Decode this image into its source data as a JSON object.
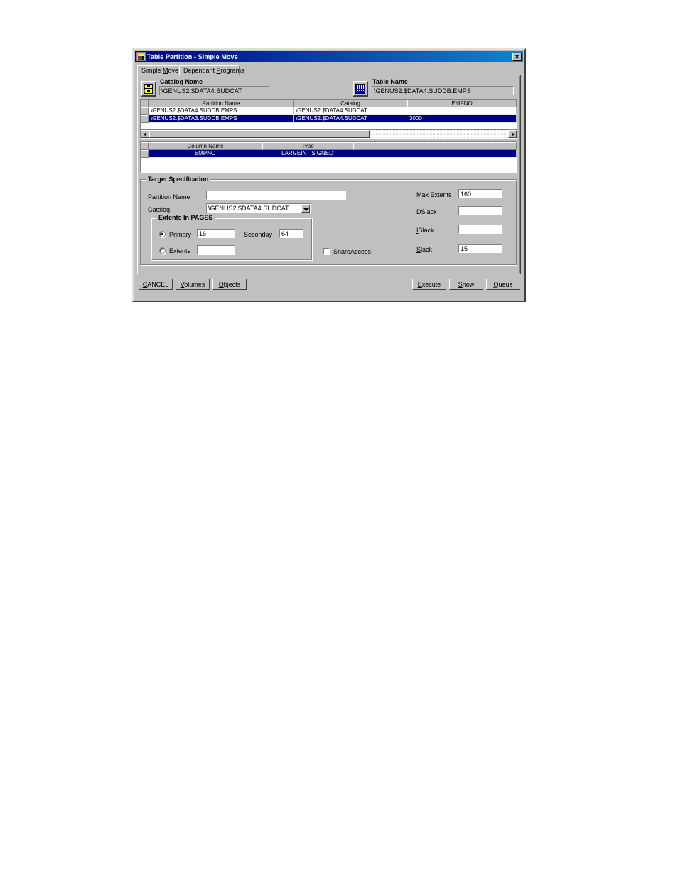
{
  "window": {
    "title": "Table Partition - Simple Move",
    "close_label": "✕",
    "icon": "app-icon"
  },
  "tabs": [
    {
      "label_pre": "Simple ",
      "label_acc": "M",
      "label_post": "ove",
      "active": true
    },
    {
      "label_pre": "Dependant ",
      "label_acc": "P",
      "label_post": "rograms",
      "active": false
    }
  ],
  "top_fields": {
    "catalog": {
      "label": "Catalog Name",
      "value": "\\GENUS2.$DATA4.SUDCAT",
      "icon": "catalog-database-icon"
    },
    "table": {
      "label": "Table Name",
      "value": "\\GENUS2.$DATA4.SUDDB.EMPS",
      "icon": "table-grid-icon"
    }
  },
  "partition_grid": {
    "columns": [
      "Partition Name",
      "Catalog",
      "EMPNO"
    ],
    "rows": [
      {
        "cells": [
          "\\GENUS2.$DATA4.SUDDB.EMPS",
          "\\GENUS2.$DATA4.SUDCAT",
          ""
        ],
        "selected": false
      },
      {
        "cells": [
          "\\GENUS2.$DATA3.SUDDB.EMPS",
          "\\GENUS2.$DATA4.SUDCAT",
          "3000"
        ],
        "selected": true
      }
    ],
    "scrollbar": {
      "left_arrow": "◄",
      "right_arrow": "►",
      "thumb_percent": 62
    }
  },
  "column_grid": {
    "columns": [
      "Column Name",
      "Type"
    ],
    "rows": [
      {
        "cells": [
          "EMPNO",
          "LARGEINT SIGNED",
          ""
        ],
        "selected": true
      }
    ]
  },
  "target_spec": {
    "title": "Target Specification",
    "partition_name": {
      "label": "Partition Name",
      "value": ""
    },
    "catalog": {
      "label_pre": "",
      "label_acc": "C",
      "label_post": "atalog",
      "value": "\\GENUS2.$DATA4.SUDCAT"
    },
    "extents_group": {
      "title": "Extents In PAGES",
      "primary": {
        "label": "Primary",
        "value": "16",
        "selected": true
      },
      "secondary": {
        "label": "Seconday",
        "value": "64"
      },
      "extents": {
        "label": "Extents",
        "value": "",
        "selected": false
      }
    },
    "share_access": {
      "label": "ShareAccess",
      "checked": false
    },
    "right_fields": [
      {
        "label_pre": "",
        "label_acc": "M",
        "label_post": "ax Extents",
        "value": "160"
      },
      {
        "label_pre": "",
        "label_acc": "D",
        "label_post": "Slack",
        "value": ""
      },
      {
        "label_pre": "",
        "label_acc": "I",
        "label_post": "Slack",
        "value": ""
      },
      {
        "label_pre": "",
        "label_acc": "S",
        "label_post": "lack",
        "value": "15"
      }
    ]
  },
  "buttons": {
    "left": [
      {
        "pre": "",
        "acc": "C",
        "post": "ANCEL"
      },
      {
        "pre": "",
        "acc": "V",
        "post": "olumes"
      },
      {
        "pre": "",
        "acc": "O",
        "post": "bjects"
      }
    ],
    "right": [
      {
        "pre": "",
        "acc": "E",
        "post": "xecute"
      },
      {
        "pre": "",
        "acc": "S",
        "post": "how"
      },
      {
        "pre": "",
        "acc": "Q",
        "post": "ueue"
      }
    ]
  },
  "colors": {
    "face": "#c0c0c0",
    "selection": "#000080",
    "title_start": "#000080",
    "title_end": "#1084d0"
  }
}
